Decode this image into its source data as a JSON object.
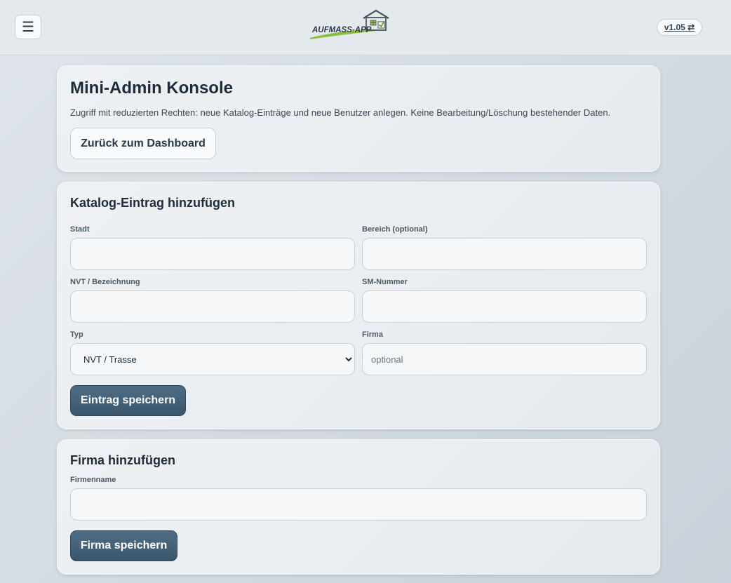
{
  "header": {
    "menu_icon": "☰",
    "logo_text": "AUFMASS-APP",
    "version_label": "v1.05 ⇄"
  },
  "console": {
    "title": "Mini-Admin Konsole",
    "description": "Zugriff mit reduzierten Rechten: neue Katalog-Einträge und neue Benutzer anlegen. Keine Bearbeitung/Löschung bestehender Daten.",
    "back_label": "Zurück zum Dashboard"
  },
  "catalog": {
    "title": "Katalog-Eintrag hinzufügen",
    "stadt_label": "Stadt",
    "stadt_value": "",
    "bereich_label": "Bereich (optional)",
    "bereich_value": "",
    "nvt_label": "NVT / Bezeichnung",
    "nvt_value": "",
    "sm_label": "SM-Nummer",
    "sm_value": "",
    "typ_label": "Typ",
    "typ_selected": "NVT / Trasse",
    "firma_label": "Firma",
    "firma_placeholder": "optional",
    "save_label": "Eintrag speichern"
  },
  "company": {
    "title": "Firma hinzufügen",
    "name_label": "Firmenname",
    "name_value": "",
    "save_label": "Firma speichern"
  },
  "colors": {
    "primary_button": "#3f5b71",
    "background": "#d4dbe2",
    "logo_green": "#8bbf3a"
  }
}
